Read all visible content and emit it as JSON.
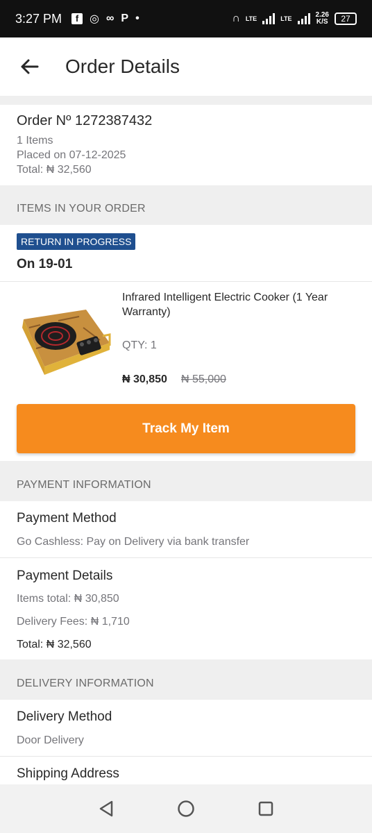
{
  "status_bar": {
    "time": "3:27 PM",
    "lte1": "LTE",
    "lte2": "LTE",
    "speed": "2.26",
    "speed_unit": "K/S",
    "battery": "27"
  },
  "app_bar": {
    "title": "Order Details"
  },
  "order": {
    "number": "Order Nº 1272387432",
    "items_count": "1 Items",
    "placed_on": "Placed on 07-12-2025",
    "total": "Total: ₦ 32,560"
  },
  "items_section": {
    "header": "ITEMS IN YOUR ORDER",
    "status_badge": "RETURN IN PROGRESS",
    "status_date": "On 19-01",
    "product": {
      "name": "Infrared Intelligent Electric Cooker (1 Year Warranty)",
      "qty": "QTY: 1",
      "price": "₦ 30,850",
      "old_price": "₦ 55,000"
    },
    "track_button": "Track My Item"
  },
  "payment_section": {
    "header": "PAYMENT INFORMATION",
    "method_title": "Payment Method",
    "method_value": "Go Cashless: Pay on Delivery via bank transfer",
    "details_title": "Payment Details",
    "items_total": "Items total: ₦ 30,850",
    "delivery_fees": "Delivery Fees: ₦ 1,710",
    "total": "Total: ₦ 32,560"
  },
  "delivery_section": {
    "header": "DELIVERY INFORMATION",
    "method_title": "Delivery Method",
    "method_value": "Door Delivery",
    "address_title": "Shipping Address"
  },
  "colors": {
    "accent": "#f68b1e",
    "badge": "#1f4f8f"
  }
}
